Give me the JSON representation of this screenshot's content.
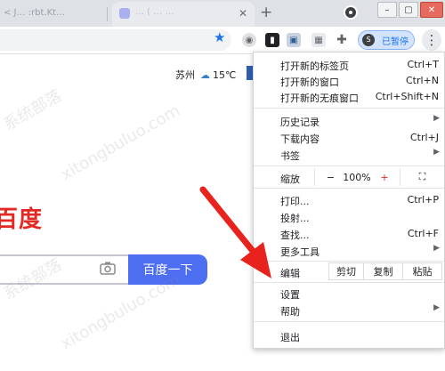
{
  "browser": {
    "tabs": [
      {
        "label": "<  J…  :rbt.Kt…"
      },
      {
        "label": "… ( … …"
      }
    ],
    "new_tab_symbol": "+",
    "window_buttons": [
      "–",
      "▢",
      "✕"
    ],
    "profile_chip": {
      "avatar_letter": "S",
      "label": "已暂停"
    }
  },
  "page": {
    "weather": {
      "city": "苏州",
      "temperature": "15℃"
    },
    "logo": "百度",
    "search_button": "百度一下",
    "watermark": [
      "系统部落",
      "xitongbuluo.com"
    ]
  },
  "menu": {
    "new_tab": {
      "label": "打开新的标签页",
      "shortcut": "Ctrl+T"
    },
    "new_window": {
      "label": "打开新的窗口",
      "shortcut": "Ctrl+N"
    },
    "incognito": {
      "label": "打开新的无痕窗口",
      "shortcut": "Ctrl+Shift+N"
    },
    "history": {
      "label": "历史记录"
    },
    "downloads": {
      "label": "下载内容",
      "shortcut": "Ctrl+J"
    },
    "bookmarks": {
      "label": "书签"
    },
    "zoom": {
      "label": "缩放",
      "minus": "−",
      "value": "100%",
      "plus": "+",
      "fullscreen": "⛶"
    },
    "print": {
      "label": "打印...",
      "shortcut": "Ctrl+P"
    },
    "cast": {
      "label": "投射..."
    },
    "find": {
      "label": "查找...",
      "shortcut": "Ctrl+F"
    },
    "more_tools": {
      "label": "更多工具"
    },
    "edit": {
      "label": "编辑",
      "cut": "剪切",
      "copy": "复制",
      "paste": "粘贴"
    },
    "settings": {
      "label": "设置"
    },
    "help": {
      "label": "帮助"
    },
    "exit": {
      "label": "退出"
    }
  },
  "colors": {
    "accent": "#1a73e8",
    "logo_red": "#e22a25",
    "search_button": "#4e6ef2",
    "annotation_arrow": "#e8221d",
    "zoom_plus": "#d93025"
  }
}
